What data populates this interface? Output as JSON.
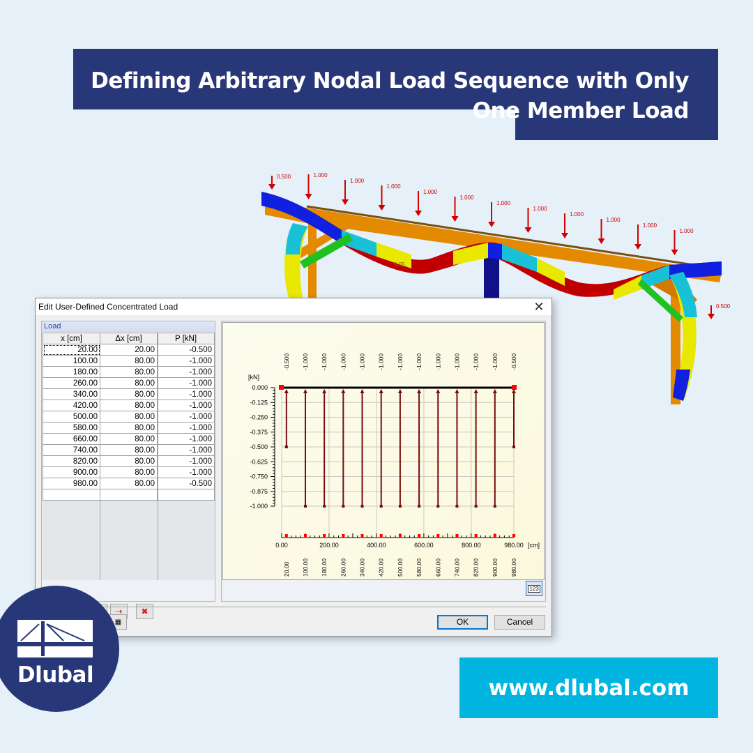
{
  "banner": {
    "title": "Defining Arbitrary Nodal Load Sequence with Only One Member Load",
    "website": "www.dlubal.com",
    "colors": {
      "navy": "#283778",
      "cyan": "#00b5e0",
      "background": "#e6f0f9"
    }
  },
  "logo": {
    "text": "Dlubal"
  },
  "model_view": {
    "load_labels": [
      "0.500",
      "1.000",
      "1.000",
      "1.000",
      "1.000",
      "1.000",
      "1.000",
      "1.000",
      "1.000",
      "1.000",
      "1.000",
      "1.000",
      "0.500"
    ],
    "deformation_label": "0.05",
    "load_color": "#d00000"
  },
  "dialog": {
    "title": "Edit User-Defined Concentrated Load",
    "panel_title": "Load",
    "columns": [
      "x [cm]",
      "Δx [cm]",
      "P [kN]"
    ],
    "rows": [
      [
        "20.00",
        "20.00",
        "-0.500"
      ],
      [
        "100.00",
        "80.00",
        "-1.000"
      ],
      [
        "180.00",
        "80.00",
        "-1.000"
      ],
      [
        "260.00",
        "80.00",
        "-1.000"
      ],
      [
        "340.00",
        "80.00",
        "-1.000"
      ],
      [
        "420.00",
        "80.00",
        "-1.000"
      ],
      [
        "500.00",
        "80.00",
        "-1.000"
      ],
      [
        "580.00",
        "80.00",
        "-1.000"
      ],
      [
        "660.00",
        "80.00",
        "-1.000"
      ],
      [
        "740.00",
        "80.00",
        "-1.000"
      ],
      [
        "820.00",
        "80.00",
        "-1.000"
      ],
      [
        "900.00",
        "80.00",
        "-1.000"
      ],
      [
        "980.00",
        "80.00",
        "-0.500"
      ],
      [
        "",
        "",
        ""
      ]
    ],
    "toolbar": [
      {
        "name": "table-view-button",
        "glyph": "▤"
      },
      {
        "name": "excel-export-button",
        "glyph": "▣"
      },
      {
        "name": "insert-row-before-button",
        "glyph": "⇠"
      },
      {
        "name": "insert-row-after-button",
        "glyph": "⇢"
      },
      {
        "name": "delete-rows-button",
        "glyph": "✖"
      }
    ],
    "graph_button_label": "123",
    "calculator_glyph": "▦",
    "ok_label": "OK",
    "cancel_label": "Cancel",
    "close_glyph": "✕"
  },
  "chart_data": {
    "type": "bar",
    "title": "",
    "ylabel": "[kN]",
    "xlabel": "[cm]",
    "x": [
      20,
      100,
      180,
      260,
      340,
      420,
      500,
      580,
      660,
      740,
      820,
      900,
      980
    ],
    "values": [
      -0.5,
      -1.0,
      -1.0,
      -1.0,
      -1.0,
      -1.0,
      -1.0,
      -1.0,
      -1.0,
      -1.0,
      -1.0,
      -1.0,
      -0.5
    ],
    "value_labels": [
      "-0.500",
      "-1.000",
      "-1.000",
      "-1.000",
      "-1.000",
      "-1.000",
      "-1.000",
      "-1.000",
      "-1.000",
      "-1.000",
      "-1.000",
      "-1.000",
      "-0.500"
    ],
    "position_labels": [
      "20.00",
      "100.00",
      "180.00",
      "260.00",
      "340.00",
      "420.00",
      "500.00",
      "580.00",
      "660.00",
      "740.00",
      "820.00",
      "900.00",
      "980.00"
    ],
    "xlim": [
      0,
      980
    ],
    "ylim": [
      -1.0,
      0.0
    ],
    "y_ticks": [
      0.0,
      -0.125,
      -0.25,
      -0.375,
      -0.5,
      -0.625,
      -0.75,
      -0.875,
      -1.0
    ],
    "y_tick_labels": [
      "0.000",
      "-0.125",
      "-0.250",
      "-0.375",
      "-0.500",
      "-0.625",
      "-0.750",
      "-0.875",
      "-1.000"
    ],
    "x_ticks": [
      0,
      200,
      400,
      600,
      800,
      980
    ],
    "x_tick_labels": [
      "0.00",
      "200.00",
      "400.00",
      "600.00",
      "800.00",
      "980.00"
    ],
    "grid": true,
    "bar_color": "#7a0c0c",
    "endpoint_color": "#ff0000"
  }
}
